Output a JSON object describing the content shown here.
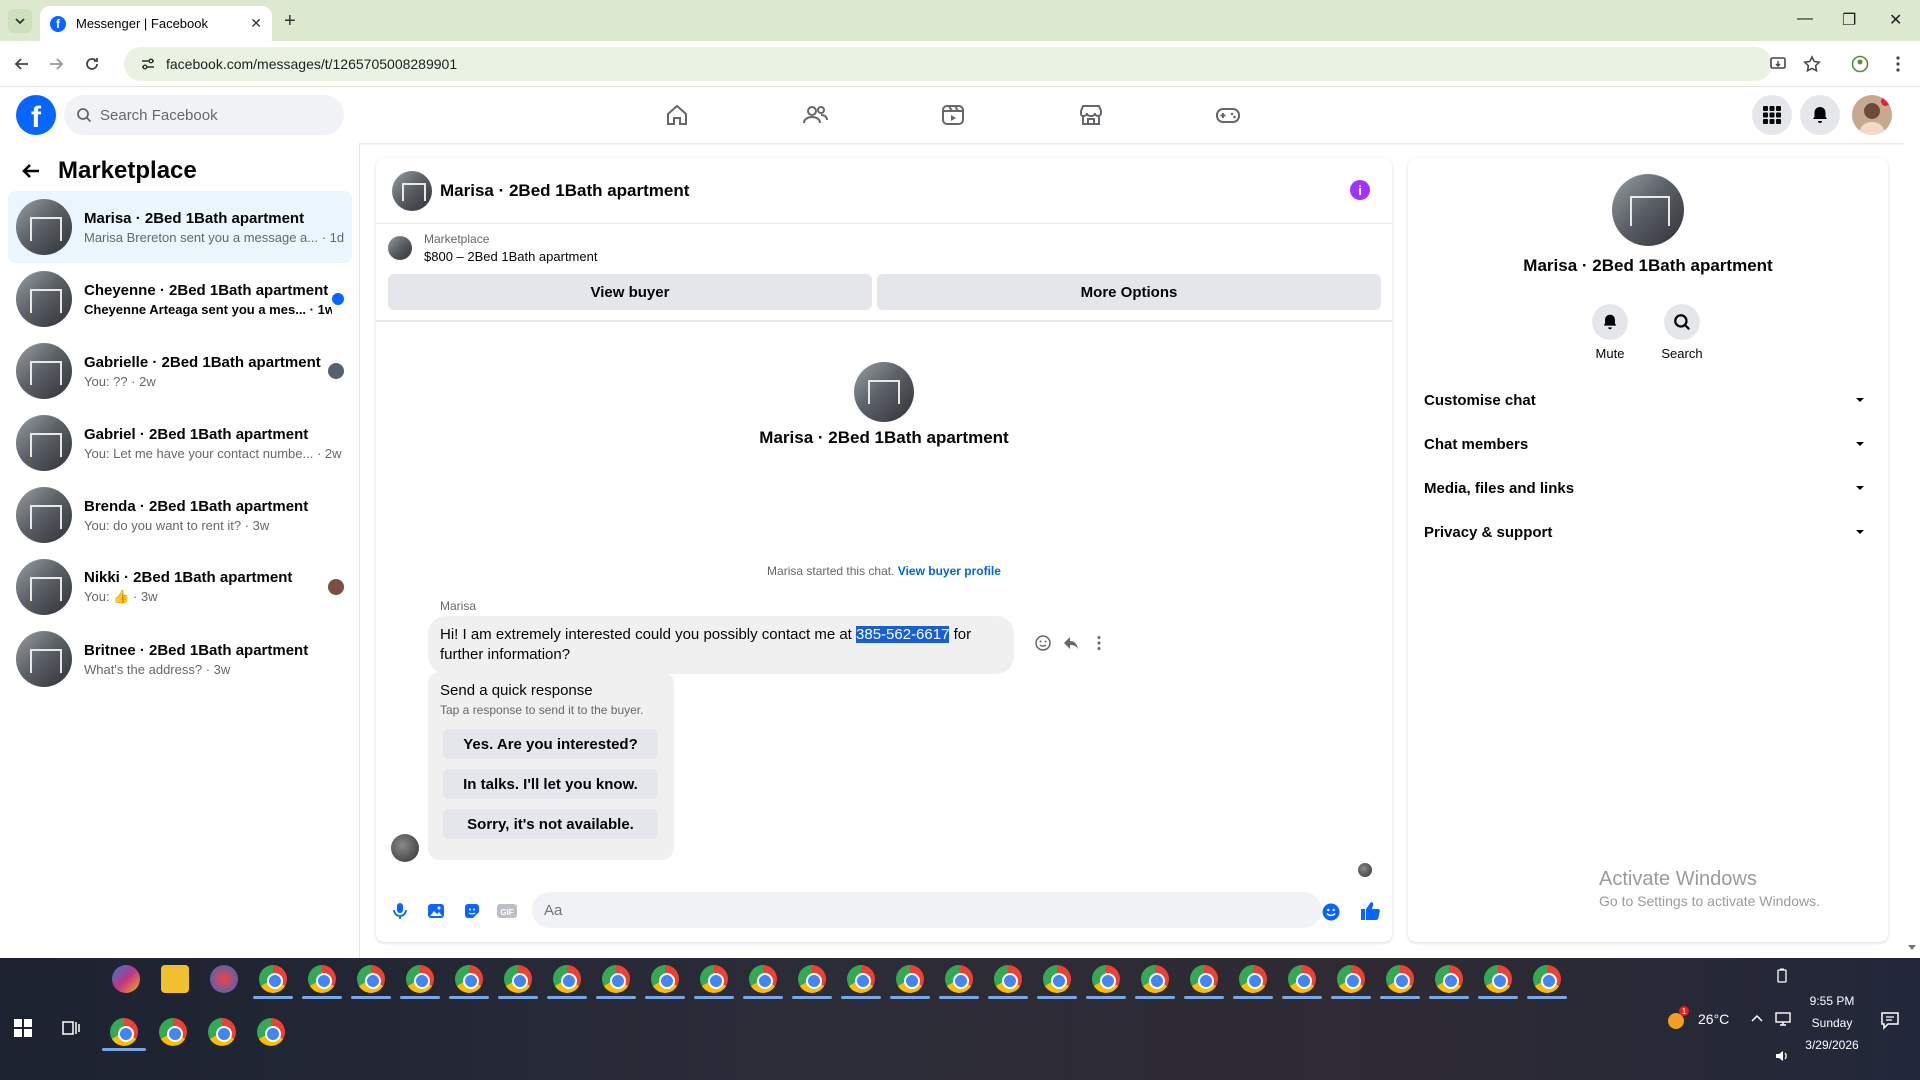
{
  "browser": {
    "tab_title": "Messenger | Facebook",
    "url": "facebook.com/messages/t/1265705008289901"
  },
  "fb": {
    "search_placeholder": "Search Facebook"
  },
  "left_panel": {
    "title": "Marketplace",
    "conversations": [
      {
        "name": "Marisa · 2Bed 1Bath apartment",
        "preview": "Marisa Brereton sent you a message a... · 1d",
        "unread": false,
        "active": true
      },
      {
        "name": "Cheyenne · 2Bed 1Bath apartment",
        "preview": "Cheyenne Arteaga sent you a mes... · 1w",
        "unread": true,
        "active": false
      },
      {
        "name": "Gabrielle · 2Bed 1Bath apartment",
        "preview": "You: ?? · 2w",
        "unread": false,
        "active": false
      },
      {
        "name": "Gabriel · 2Bed 1Bath apartment",
        "preview": "You: Let me have your contact numbe... · 2w",
        "unread": false,
        "active": false
      },
      {
        "name": "Brenda · 2Bed 1Bath apartment",
        "preview": "You: do you want to rent it? · 3w",
        "unread": false,
        "active": false
      },
      {
        "name": "Nikki · 2Bed 1Bath apartment",
        "preview": "You: 👍 · 3w",
        "unread": false,
        "active": false
      },
      {
        "name": "Britnee · 2Bed 1Bath apartment",
        "preview": "What's the address? · 3w",
        "unread": false,
        "active": false
      }
    ]
  },
  "chat": {
    "title": "Marisa · 2Bed 1Bath apartment",
    "listing_label": "Marketplace",
    "listing_price": "$800 – 2Bed 1Bath apartment",
    "view_buyer": "View buyer",
    "more_options": "More Options",
    "intro_name": "Marisa · 2Bed 1Bath apartment",
    "started_text": "Marisa started this chat.",
    "view_buyer_profile": "View buyer profile",
    "sender": "Marisa",
    "message_before": "Hi! I am extremely interested could you possibly contact me at ",
    "message_highlight": "385-562-6617",
    "message_after": " for further information?",
    "quick_title": "Send a quick response",
    "quick_sub": "Tap a response to send it to the buyer.",
    "quick_responses": [
      "Yes. Are you interested?",
      "In talks. I'll let you know.",
      "Sorry, it's not available."
    ],
    "input_placeholder": "Aa"
  },
  "right_panel": {
    "name": "Marisa · 2Bed 1Bath apartment",
    "mute": "Mute",
    "search": "Search",
    "sections": [
      "Customise chat",
      "Chat members",
      "Media, files and links",
      "Privacy & support"
    ]
  },
  "watermark": {
    "line1": "Activate Windows",
    "line2": "Go to Settings to activate Windows."
  },
  "tray": {
    "temperature": "26°C",
    "time": "9:55 PM",
    "day": "Sunday",
    "date": "3/29/2026",
    "weather_badge": "1"
  },
  "colors": {
    "accent": "#0866ff",
    "info": "#a033ff",
    "highlight": "#1a5fd0"
  }
}
